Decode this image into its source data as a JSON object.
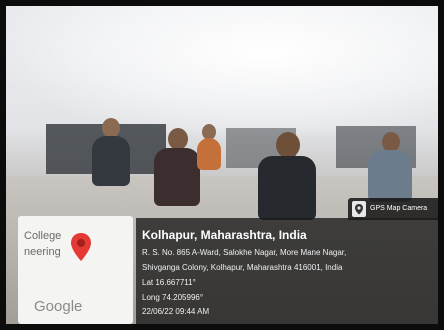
{
  "map_card": {
    "label_line1": "College",
    "label_line2": "neering",
    "logo": "Google"
  },
  "badge": {
    "label": "GPS Map Camera",
    "icon": "gps-map-camera-icon"
  },
  "location": {
    "title": "Kolhapur, Maharashtra, India",
    "address_line1": "R. S. No. 865 A-Ward, Salokhe Nagar, More Mane Nagar,",
    "address_line2": "Shivganga Colony, Kolhapur, Maharashtra 416001, India",
    "lat": "Lat 16.667711°",
    "long": "Long 74.205996°",
    "datetime": "22/06/22 09:44 AM"
  }
}
